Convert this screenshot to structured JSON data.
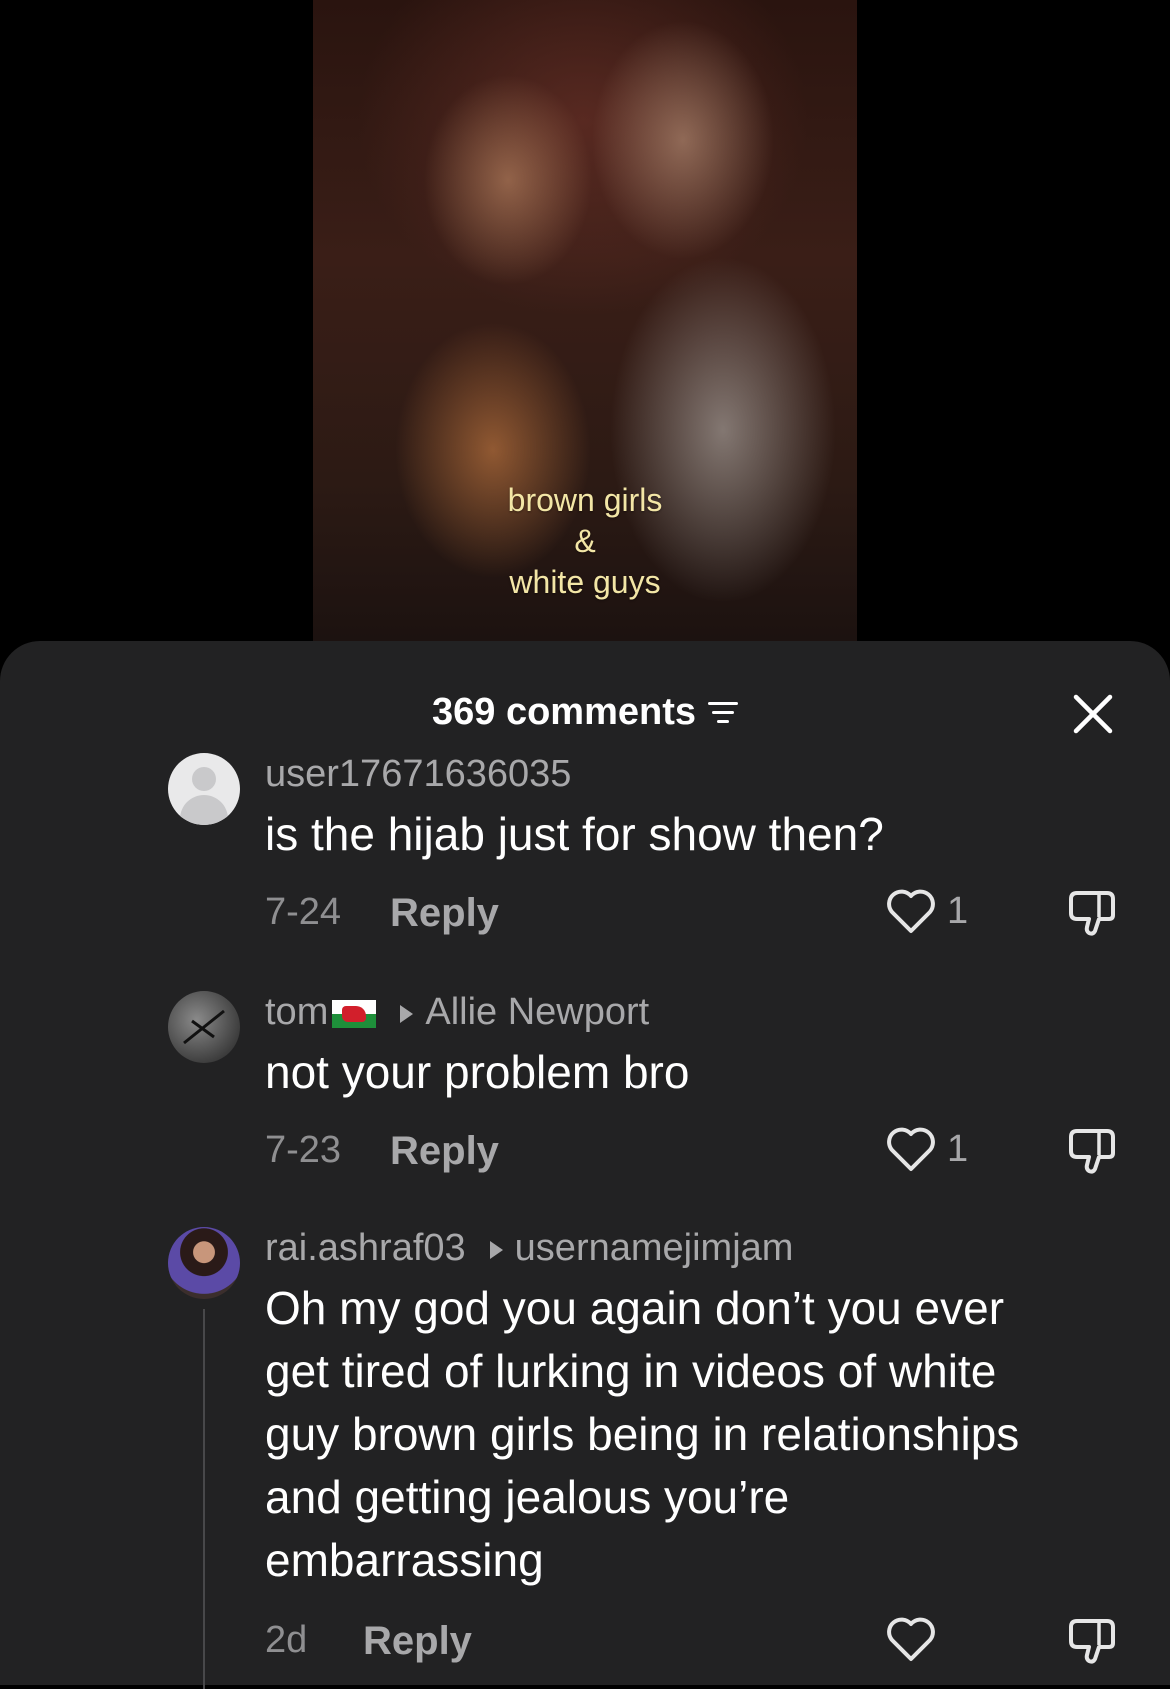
{
  "video": {
    "caption_lines": [
      "brown girls",
      "&",
      "white guys"
    ]
  },
  "header": {
    "comment_count": "369 comments"
  },
  "comments": [
    {
      "username": "user17671636035",
      "text": "is the hijab just for show then?",
      "date": "7-24",
      "reply_label": "Reply",
      "likes": "1"
    },
    {
      "username": "tom",
      "reply_to": "Allie Newport",
      "text": "not your problem bro",
      "date": "7-23",
      "reply_label": "Reply",
      "likes": "1"
    },
    {
      "username": "rai.ashraf03",
      "reply_to": "usernamejimjam",
      "text_lines": [
        "Oh my god you again don’t you ever",
        "get tired of lurking in videos of white",
        "guy brown girls being in relationships",
        "and getting jealous you’re",
        "embarrassing"
      ],
      "date": "2d",
      "reply_label": "Reply",
      "likes": ""
    }
  ]
}
